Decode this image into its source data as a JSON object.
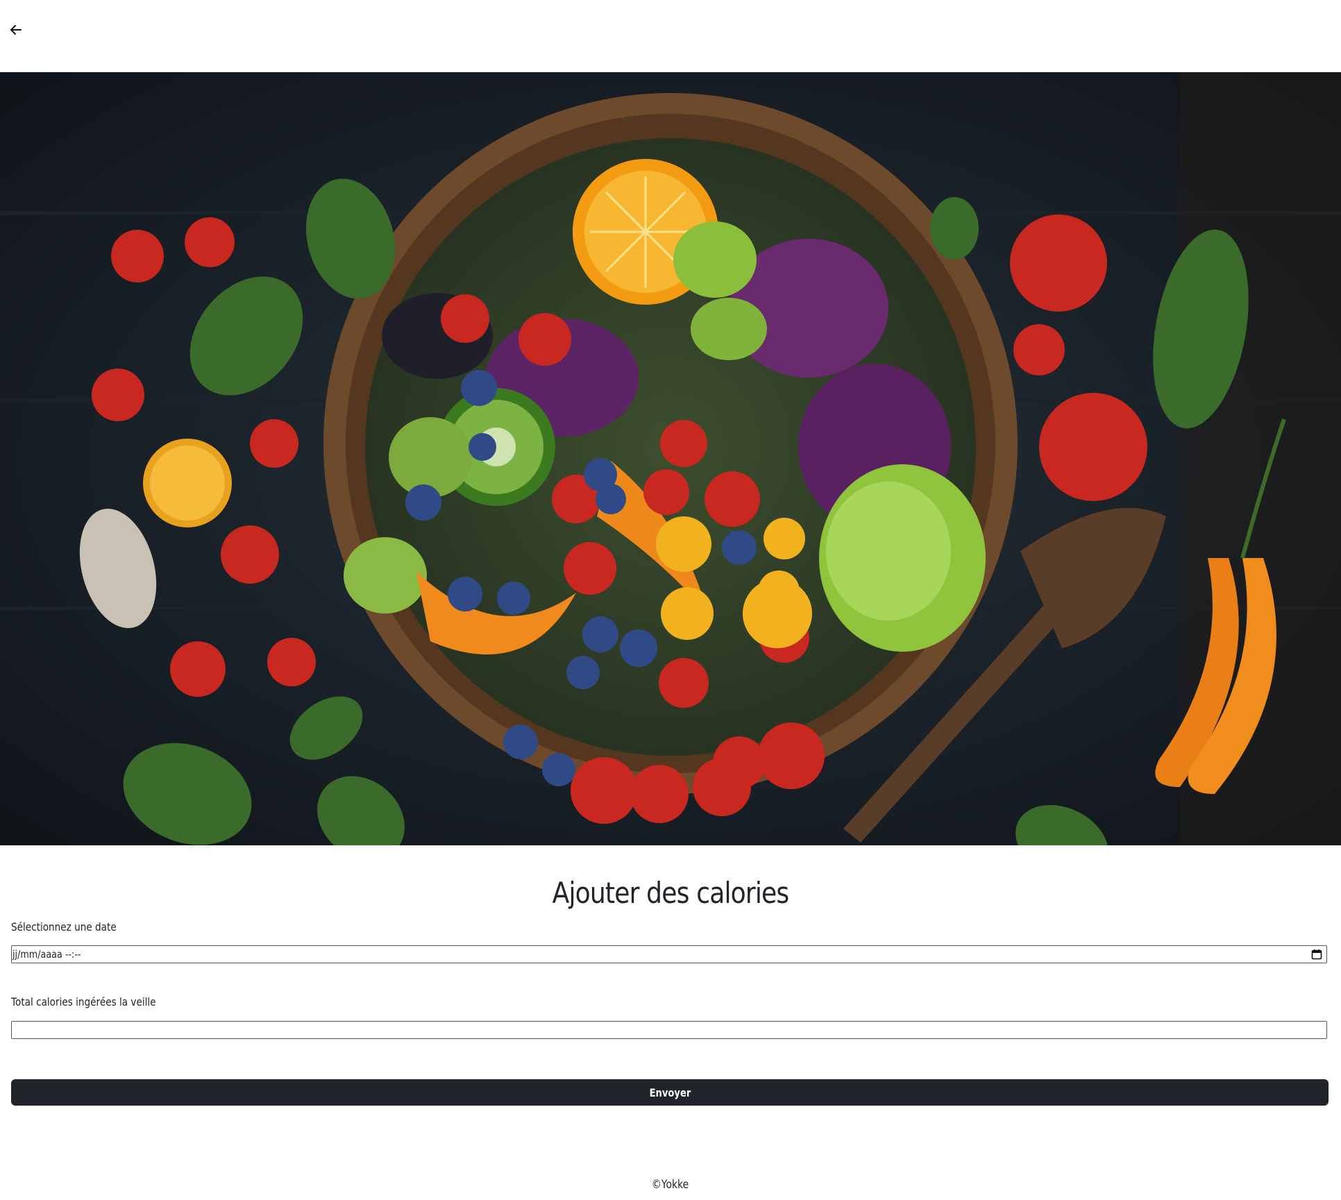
{
  "nav": {
    "back_icon": "arrow-left-icon"
  },
  "hero": {
    "image": "salad-bowl-photo"
  },
  "form": {
    "title": "Ajouter des calories",
    "date_label": "Sélectionnez une date",
    "date_value": "jj/mm/aaaa --:--",
    "date_icon": "calendar-icon",
    "calories_label": "Total calories ingérées la veille",
    "calories_value": "",
    "submit_label": "Envoyer"
  },
  "footer": {
    "text": "©Yokke"
  },
  "colors": {
    "button_bg": "#212529",
    "text": "#212529",
    "background": "#ffffff"
  }
}
